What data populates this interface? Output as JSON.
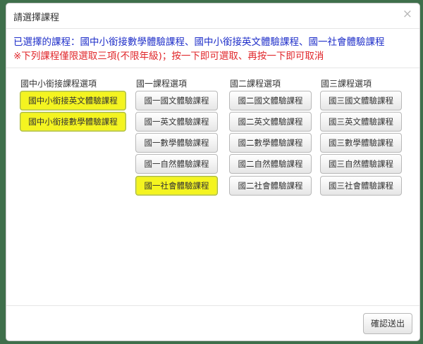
{
  "dialog": {
    "title": "請選擇課程",
    "close_glyph": "×",
    "selected_text": "已選擇的課程：國中小銜接數學體驗課程、國中小銜接英文體驗課程、國一社會體驗課程",
    "notice_text": "※下列課程僅限選取三項(不限年級)；按一下即可選取、再按一下即可取消",
    "submit_label": "確認送出"
  },
  "columns": [
    {
      "title": "國中小銜接課程選項",
      "options": [
        {
          "label": "國中小銜接英文體驗課程",
          "selected": true
        },
        {
          "label": "國中小銜接數學體驗課程",
          "selected": true
        }
      ]
    },
    {
      "title": "國一課程選項",
      "options": [
        {
          "label": "國一國文體驗課程",
          "selected": false
        },
        {
          "label": "國一英文體驗課程",
          "selected": false
        },
        {
          "label": "國一數學體驗課程",
          "selected": false
        },
        {
          "label": "國一自然體驗課程",
          "selected": false
        },
        {
          "label": "國一社會體驗課程",
          "selected": true
        }
      ]
    },
    {
      "title": "國二課程選項",
      "options": [
        {
          "label": "國二國文體驗課程",
          "selected": false
        },
        {
          "label": "國二英文體驗課程",
          "selected": false
        },
        {
          "label": "國二數學體驗課程",
          "selected": false
        },
        {
          "label": "國二自然體驗課程",
          "selected": false
        },
        {
          "label": "國二社會體驗課程",
          "selected": false
        }
      ]
    },
    {
      "title": "國三課程選項",
      "options": [
        {
          "label": "國三國文體驗課程",
          "selected": false
        },
        {
          "label": "國三英文體驗課程",
          "selected": false
        },
        {
          "label": "國三數學體驗課程",
          "selected": false
        },
        {
          "label": "國三自然體驗課程",
          "selected": false
        },
        {
          "label": "國三社會體驗課程",
          "selected": false
        }
      ]
    }
  ],
  "colors": {
    "selected_bg": "#f4f420",
    "selected_text_blue": "#1f2fc9",
    "notice_red": "#e0262a",
    "backdrop": "#3f6f4b"
  }
}
